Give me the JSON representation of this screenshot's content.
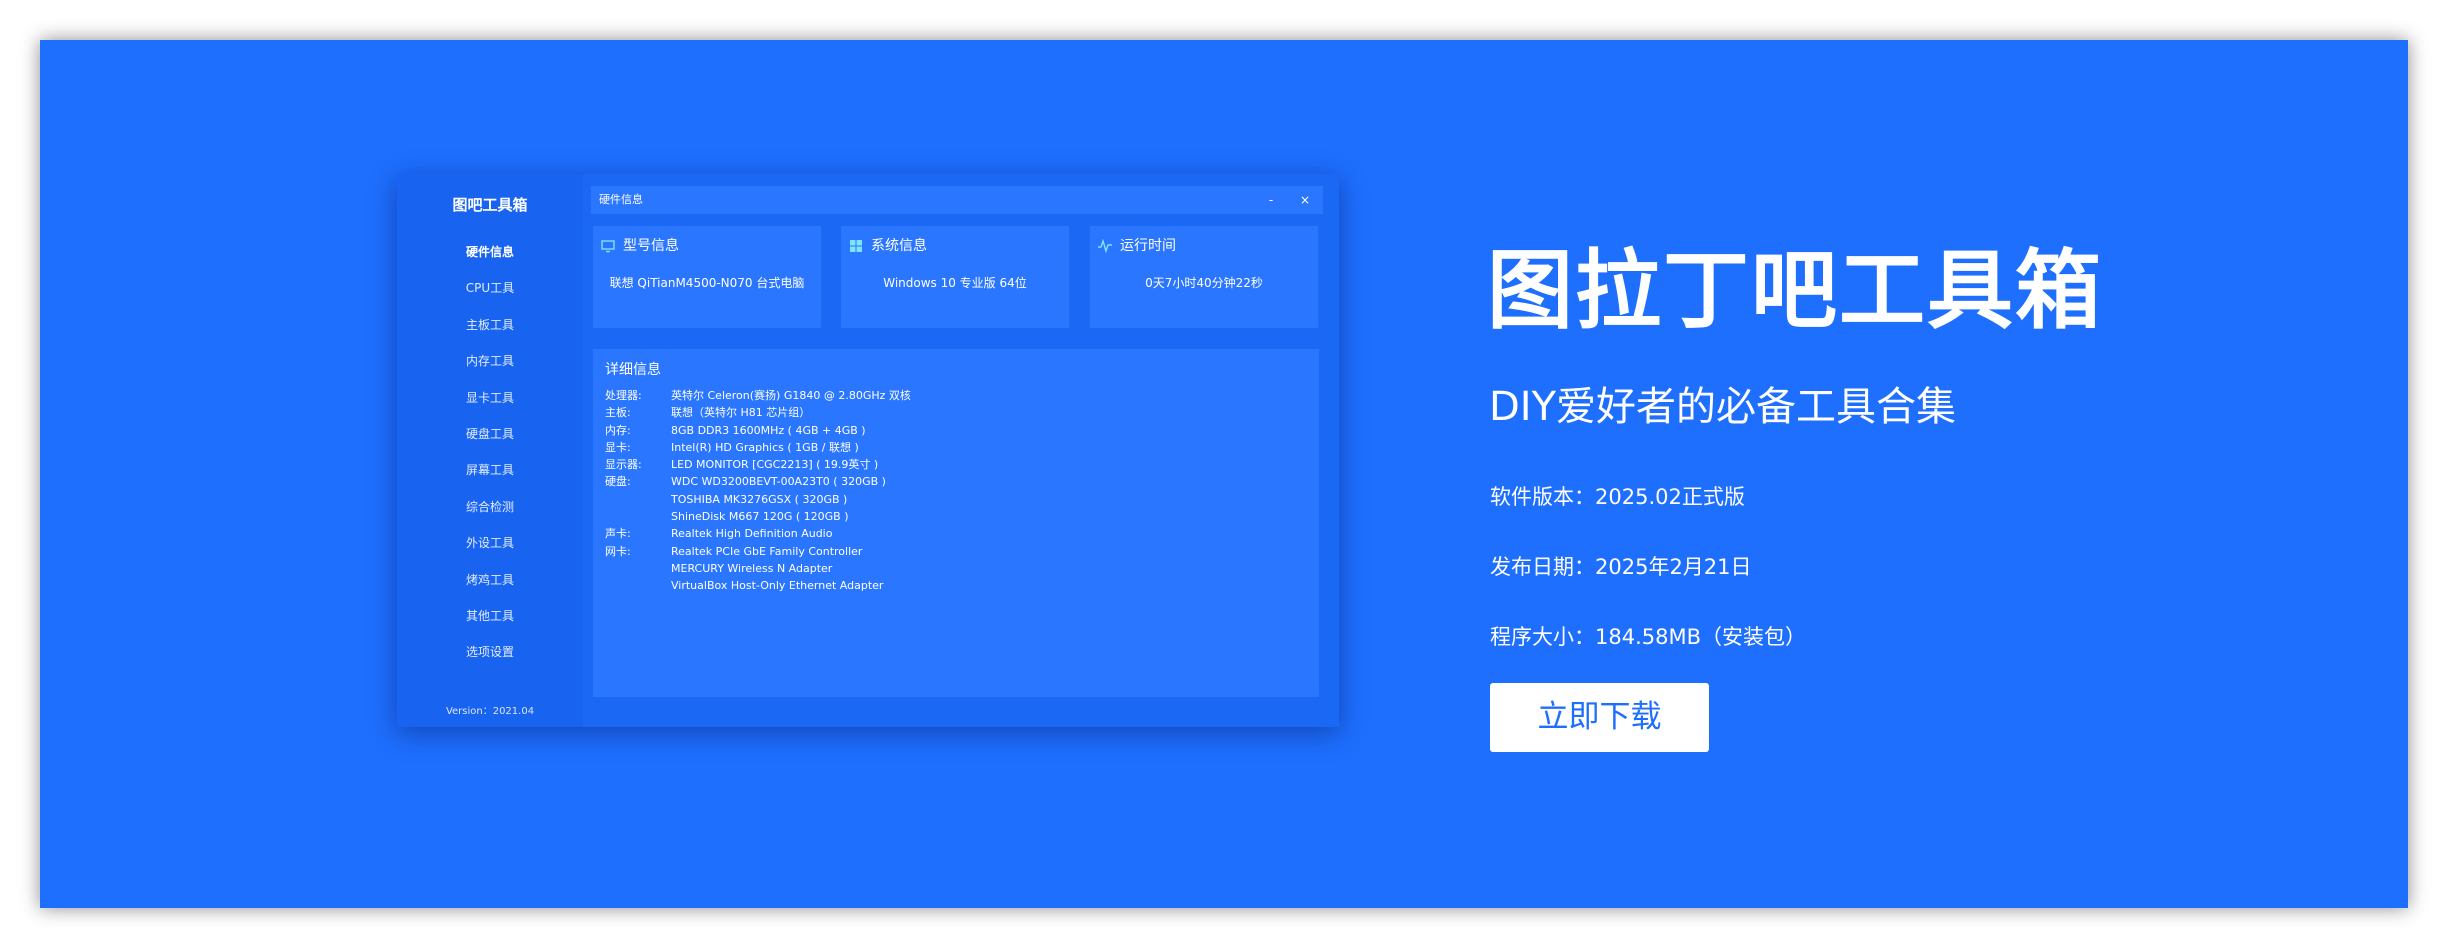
{
  "app": {
    "title": "图吧工具箱",
    "version": "Version：2021.04",
    "sidebar_items": [
      {
        "label": "硬件信息"
      },
      {
        "label": "CPU工具"
      },
      {
        "label": "主板工具"
      },
      {
        "label": "内存工具"
      },
      {
        "label": "显卡工具"
      },
      {
        "label": "硬盘工具"
      },
      {
        "label": "屏幕工具"
      },
      {
        "label": "综合检测"
      },
      {
        "label": "外设工具"
      },
      {
        "label": "烤鸡工具"
      },
      {
        "label": "其他工具"
      },
      {
        "label": "选项设置"
      }
    ],
    "window_title": "硬件信息",
    "minimize": "-",
    "close": "×",
    "cards": [
      {
        "label": "型号信息",
        "value": "联想 QiTianM4500-N070 台式电脑",
        "icon": "monitor-icon"
      },
      {
        "label": "系统信息",
        "value": "Windows 10 专业版 64位",
        "icon": "windows-icon"
      },
      {
        "label": "运行时间",
        "value": "0天7小时40分钟22秒",
        "icon": "pulse-icon"
      }
    ],
    "details": {
      "title": "详细信息",
      "rows": [
        {
          "label": "处理器:",
          "value": "英特尔 Celeron(赛扬) G1840 @ 2.80GHz 双核"
        },
        {
          "label": "主板:",
          "value": "联想（英特尔 H81 芯片组）"
        },
        {
          "label": "内存:",
          "value": "8GB DDR3 1600MHz ( 4GB + 4GB )"
        },
        {
          "label": "显卡:",
          "value": "Intel(R) HD Graphics ( 1GB / 联想 )"
        },
        {
          "label": "显示器:",
          "value": "LED MONITOR [CGC2213] ( 19.9英寸 )"
        },
        {
          "label": "硬盘:",
          "value": "WDC WD3200BEVT-00A23T0 ( 320GB )"
        },
        {
          "label": "",
          "value": "TOSHIBA MK3276GSX ( 320GB )"
        },
        {
          "label": "",
          "value": "ShineDisk M667 120G ( 120GB )"
        },
        {
          "label": "声卡:",
          "value": "Realtek High Definition Audio"
        },
        {
          "label": "网卡:",
          "value": "Realtek PCIe GbE Family Controller"
        },
        {
          "label": "",
          "value": "MERCURY Wireless N Adapter"
        },
        {
          "label": "",
          "value": "VirtualBox Host-Only Ethernet Adapter"
        }
      ]
    }
  },
  "hero": {
    "title": "图拉丁吧工具箱",
    "subtitle": "DIY爱好者的必备工具合集",
    "version": "软件版本：2025.02正式版",
    "release_date": "发布日期：2025年2月21日",
    "size": "程序大小：184.58MB（安装包）",
    "download_button": "立即下载"
  },
  "colors": {
    "background": "#1e6ffe",
    "panel": "#2a76ff",
    "button_bg": "#ffffff",
    "button_text": "#1e6ffe"
  }
}
